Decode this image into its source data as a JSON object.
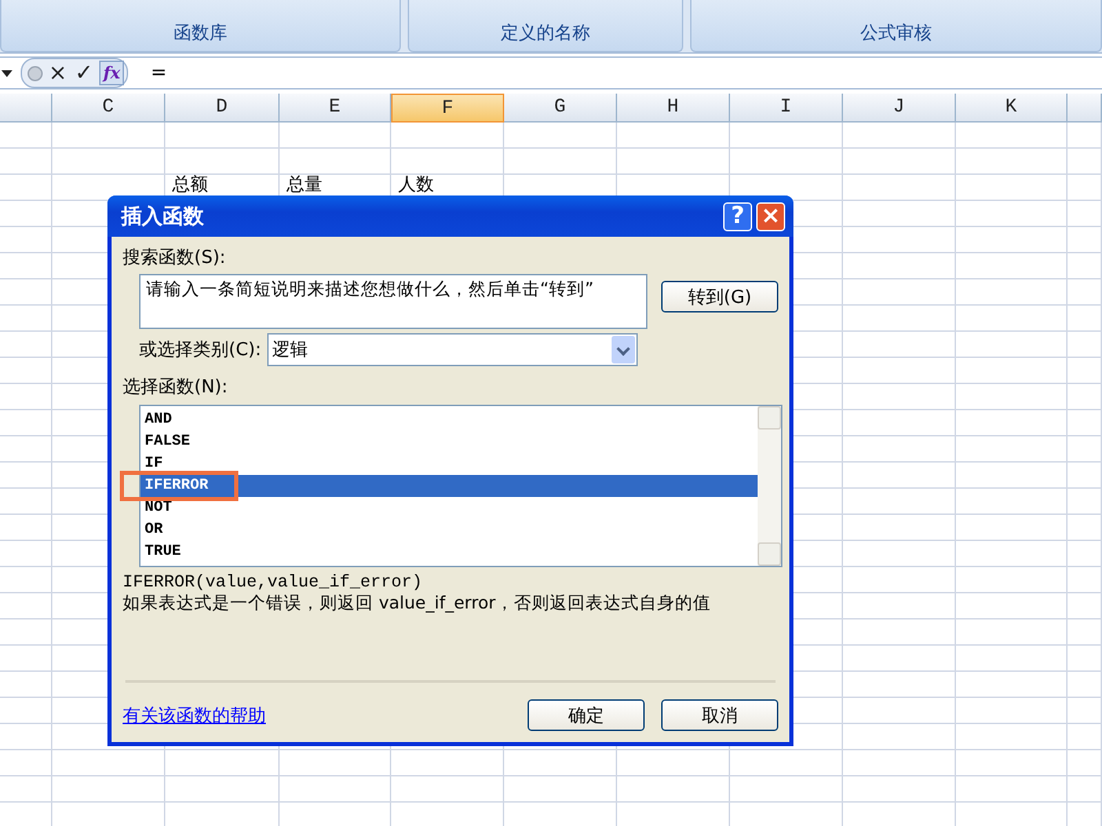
{
  "ribbon": {
    "groups": [
      "函数库",
      "定义的名称",
      "公式审核"
    ]
  },
  "formula_bar": {
    "cancel": "×",
    "enter": "✓",
    "function": "fx",
    "value": "="
  },
  "sheet": {
    "columns": [
      {
        "selected": false
      },
      {
        "label": "C",
        "selected": false
      },
      {
        "label": "D",
        "selected": false
      },
      {
        "label": "E",
        "selected": false
      },
      {
        "label": "F",
        "selected": true
      },
      {
        "label": "G",
        "selected": false
      },
      {
        "label": "H",
        "selected": false
      },
      {
        "label": "I",
        "selected": false
      },
      {
        "label": "J",
        "selected": false
      },
      {
        "label": "K",
        "selected": false
      },
      {
        "selected": false
      }
    ],
    "rows": [
      {
        "cells": []
      },
      {
        "cells": []
      },
      {
        "cells": [
          {},
          {},
          {
            "text": "总额"
          },
          {
            "text": "总量"
          },
          {
            "text": "人数"
          }
        ]
      }
    ]
  },
  "dialog": {
    "title": "插入函数",
    "help": "?",
    "close": "×",
    "search_label": "搜索函数(S):",
    "search_value": "请输入一条简短说明来描述您想做什么，然后单击“转到”",
    "go_button": "转到(G)",
    "category_label": "或选择类别(C):",
    "category_value": "逻辑",
    "list_label": "选择函数(N):",
    "functions": [
      {
        "name": "AND",
        "selected": false
      },
      {
        "name": "FALSE",
        "selected": false
      },
      {
        "name": "IF",
        "selected": false
      },
      {
        "name": "IFERROR",
        "selected": true
      },
      {
        "name": "NOT",
        "selected": false
      },
      {
        "name": "OR",
        "selected": false
      },
      {
        "name": "TRUE",
        "selected": false
      }
    ],
    "signature": "IFERROR(value,value_if_error)",
    "description": "如果表达式是一个错误，则返回 value_if_error，否则返回表达式自身的值",
    "help_link": "有关该函数的帮助",
    "ok": "确定",
    "cancel": "取消"
  }
}
